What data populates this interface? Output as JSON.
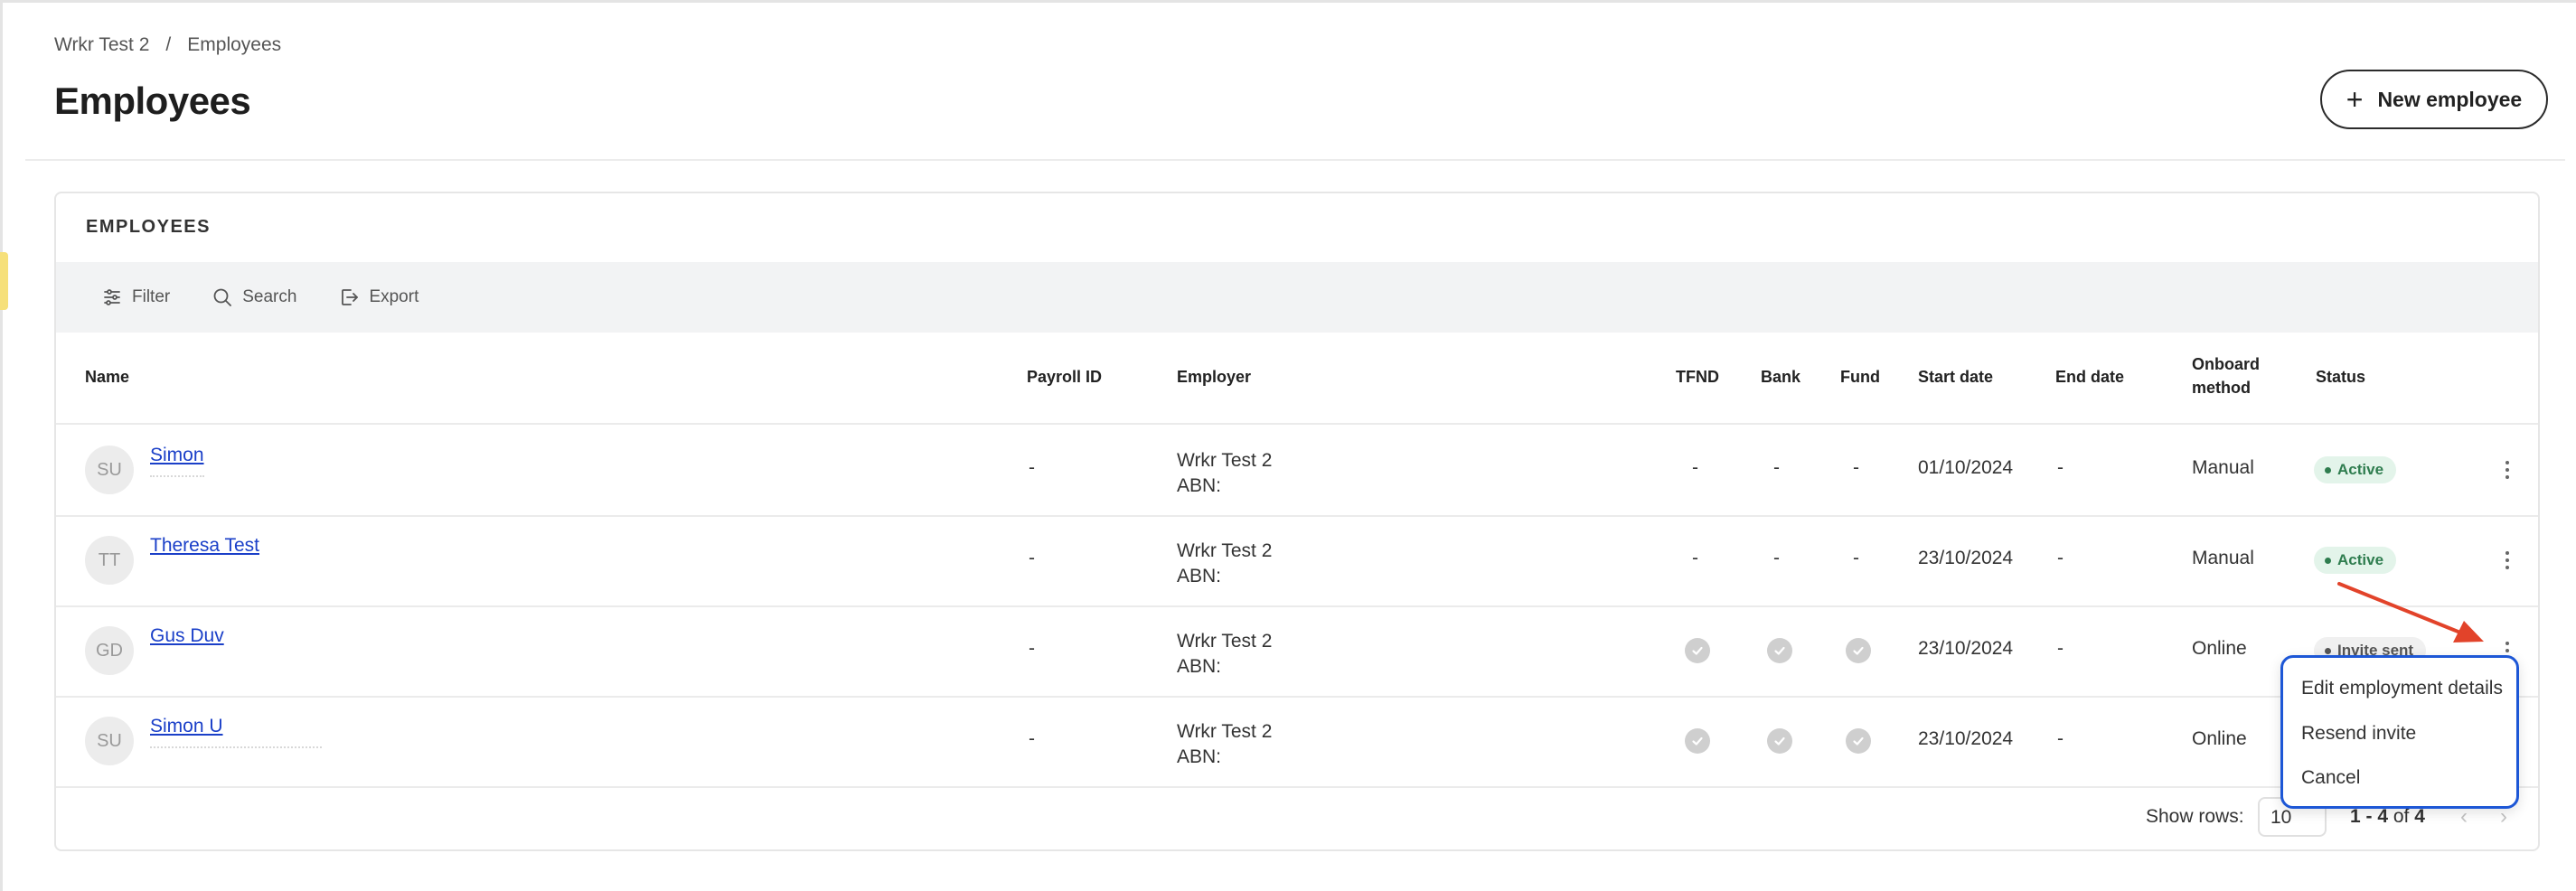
{
  "breadcrumb": {
    "parent": "Wrkr Test 2",
    "separator": "/",
    "current": "Employees"
  },
  "page": {
    "title": "Employees",
    "new_button_label": "New employee"
  },
  "card": {
    "title": "EMPLOYEES"
  },
  "toolbar": {
    "filter_label": "Filter",
    "search_label": "Search",
    "export_label": "Export"
  },
  "table": {
    "headers": {
      "name": "Name",
      "payroll_id": "Payroll ID",
      "employer": "Employer",
      "tfnd": "TFND",
      "bank": "Bank",
      "fund": "Fund",
      "start_date": "Start date",
      "end_date": "End date",
      "onboard_method_1": "Onboard",
      "onboard_method_2": "method",
      "status": "Status"
    },
    "rows": [
      {
        "initials": "SU",
        "name": "Simon ",
        "payroll_id": "-",
        "employer": "Wrkr Test 2",
        "abn": "ABN:",
        "tfnd": "-",
        "bank": "-",
        "fund": "-",
        "start_date": "01/10/2024",
        "end_date": "-",
        "onboard_method": "Manual",
        "status": "Active"
      },
      {
        "initials": "TT",
        "name": "Theresa Test",
        "payroll_id": "-",
        "employer": "Wrkr Test 2",
        "abn": "ABN:",
        "tfnd": "-",
        "bank": "-",
        "fund": "-",
        "start_date": "23/10/2024",
        "end_date": "-",
        "onboard_method": "Manual",
        "status": "Active"
      },
      {
        "initials": "GD",
        "name": "Gus Duv",
        "payroll_id": "-",
        "employer": "Wrkr Test 2",
        "abn": "ABN:",
        "start_date": "23/10/2024",
        "end_date": "-",
        "onboard_method": "Online",
        "status": "Invite sent"
      },
      {
        "initials": "SU",
        "name": "Simon U",
        "payroll_id": "-",
        "employer": "Wrkr Test 2",
        "abn": "ABN:",
        "start_date": "23/10/2024",
        "end_date": "-",
        "onboard_method": "Online"
      }
    ]
  },
  "pagination": {
    "show_rows_label": "Show rows:",
    "rows_value": "10",
    "range_start": "1 - 4",
    "range_of": "of",
    "range_total": "4",
    "prev_icon": "‹",
    "next_icon": "›"
  },
  "row_menu": {
    "items": [
      "Edit employment details",
      "Resend invite",
      "Cancel"
    ]
  },
  "colors": {
    "link": "#1a3fc8",
    "active_badge_bg": "#e3f4ea",
    "active_badge_text": "#2f7d4f",
    "menu_border": "#1d57d6",
    "annotation_arrow": "#e2432a",
    "edge_accent": "#f6e07a"
  },
  "icons": {
    "filter": "sliders-icon",
    "search": "search-icon",
    "export": "export-icon",
    "add": "plus-icon",
    "row_actions": "kebab-icon",
    "check": "check-circle-icon"
  }
}
